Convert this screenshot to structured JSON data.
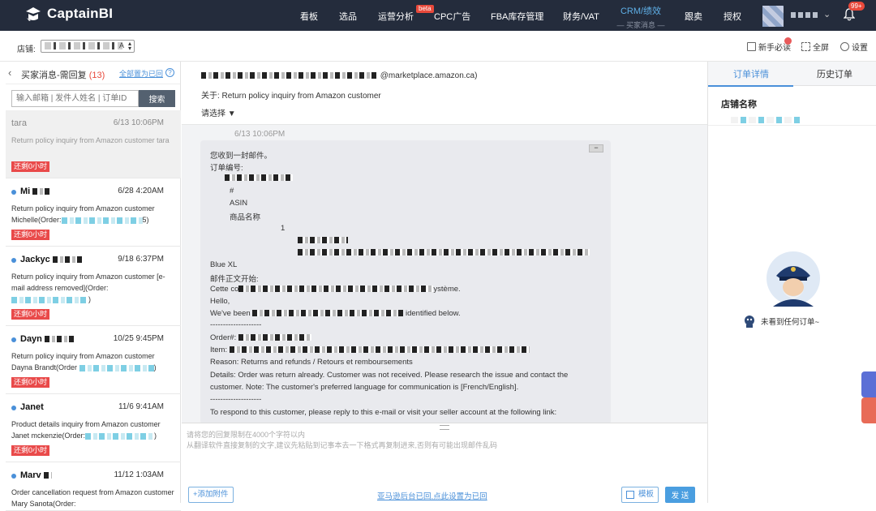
{
  "app": {
    "name": "CaptainBI",
    "notification_count": "99+"
  },
  "nav": [
    {
      "label": "看板"
    },
    {
      "label": "选品"
    },
    {
      "label": "运营分析"
    },
    {
      "label": "CPC广告"
    },
    {
      "label": "FBA库存管理"
    },
    {
      "label": "财务/VAT"
    },
    {
      "label": "跟卖"
    },
    {
      "label": "授权"
    }
  ],
  "nav_beta": "beta",
  "crm": {
    "label": "CRM/绩效",
    "sub": "— 买家消息 —"
  },
  "subbar": {
    "shop_label": "店铺:",
    "shop_value": "A",
    "guide": "新手必读",
    "fullscreen": "全屏",
    "settings": "设置"
  },
  "list_header": {
    "title": "买家消息-需回复",
    "count": "(13)",
    "mark_all": "全部置为已回",
    "help": "?"
  },
  "search": {
    "placeholder": "输入邮箱 | 发件人姓名 | 订单ID",
    "button": "搜索"
  },
  "messages": [
    {
      "from": "tara",
      "date": "6/13 10:06PM",
      "snippet": "Return policy inquiry from Amazon customer tara",
      "tag": "还剩0小时"
    },
    {
      "from": "Mi",
      "date": "6/28 4:20AM",
      "snippet": "Return policy inquiry from Amazon customer Michelle(Order:",
      "snippet_end": "5)",
      "tag": "还剩0小时"
    },
    {
      "from": "Jackyc",
      "date": "9/18 6:37PM",
      "snippet": "Return policy inquiry from Amazon customer [e-mail address removed](Order:",
      "snippet_end": ")",
      "tag": "还剩0小时"
    },
    {
      "from": "Dayn",
      "date": "10/25 9:45PM",
      "snippet": "Return policy inquiry from Amazon customer Dayna Brandt(Order",
      "snippet_end": ")",
      "tag": "还剩0小时"
    },
    {
      "from": "Janet",
      "date": "11/6 9:41AM",
      "snippet": "Product details inquiry from Amazon customer Janet mckenzie(Order:",
      "snippet_end": ")",
      "tag": "还剩0小时"
    },
    {
      "from": "Marv",
      "date": "11/12 1:03AM",
      "snippet": "Order cancellation request from Amazon customer Mary Sanota(Order:",
      "snippet_end": "",
      "tag": ""
    }
  ],
  "mail": {
    "to_suffix": "@marketplace.amazon.ca)",
    "subject": "关于:  Return policy inquiry from Amazon customer",
    "pick": "请选择",
    "time": "6/13 10:06PM",
    "collapse": "−",
    "body": {
      "l1": "您收到一封邮件。",
      "l2": "订单编号:",
      "l3": "#",
      "l4": "ASIN",
      "l5": "商品名称",
      "l6": "1",
      "l7": "Blue XL",
      "l8": "邮件正文开始:",
      "l9a": "Cette co",
      "l9b": "ystème.",
      "l10": "Hello,",
      "l11a": "We've been",
      "l11b": "identified below.",
      "l12": "--------------------",
      "l13": "Order#:",
      "l14": "Item:",
      "l15": "Reason: Returns and refunds / Retours et remboursements",
      "l16": "Details: Order was return already. Customer was not received. Please research the issue and contact the",
      "l17": "customer. Note: The customer's preferred language for communication is [French/English].",
      "l18": "--------------------",
      "l19": "To respond to this customer, please reply to this e-mail or visit your seller account at the following link:"
    }
  },
  "reply": {
    "ph1": "请将您的回复限制在4000个字符以内",
    "ph2": "从翻译软件直接复制的文字,建议先粘贴到记事本去一下格式再复制进来,否则有可能出现邮件乱码",
    "attach": "+添加附件",
    "mark_read": "亚马逊后台已回,点此设置为已回",
    "template": "模板",
    "send": "发 送"
  },
  "right": {
    "tab1": "订单详情",
    "tab2": "历史订单",
    "shop_name": "店铺名称",
    "no_order": "未看到任何订单~"
  }
}
